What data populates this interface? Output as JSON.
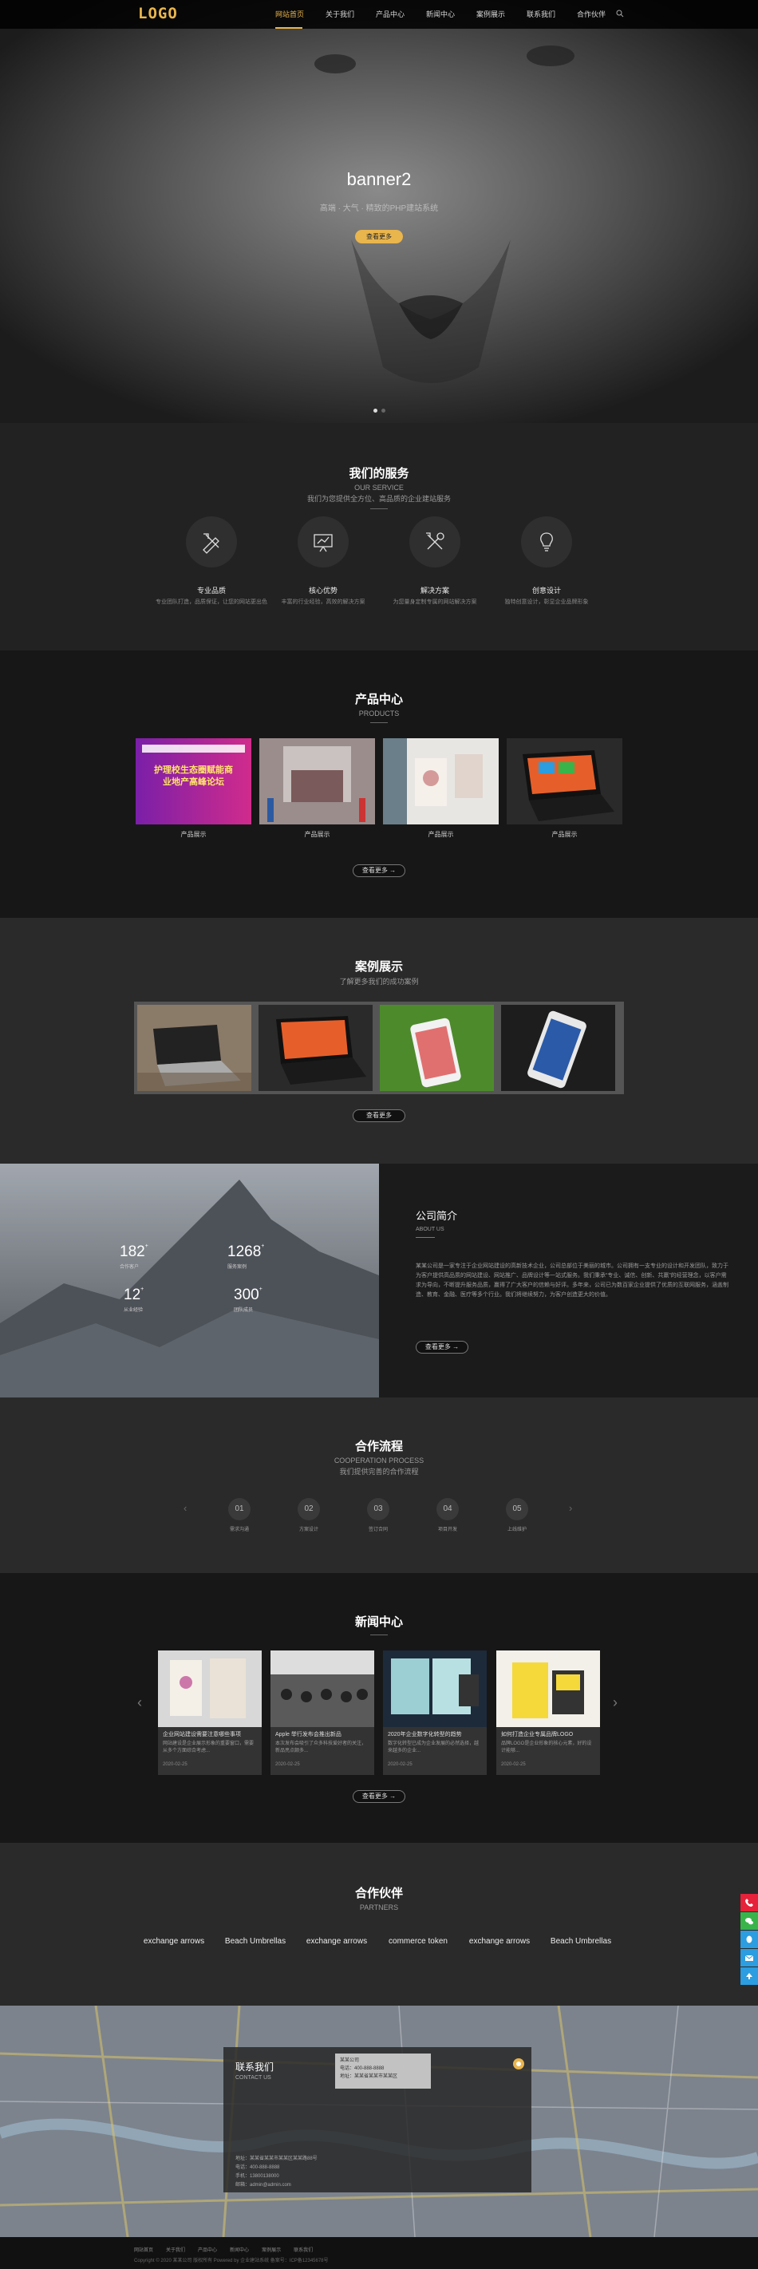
{
  "header": {
    "logo": "LOGO",
    "nav": [
      "网站首页",
      "关于我们",
      "产品中心",
      "新闻中心",
      "案例展示",
      "联系我们",
      "合作伙伴"
    ],
    "colors": {
      "accent": "#e9b54d"
    }
  },
  "hero": {
    "title": "banner2",
    "subtitle": "高端 · 大气 · 精致的PHP建站系统",
    "button": "查看更多"
  },
  "services": {
    "title": "我们的服务",
    "en": "OUR SERVICE",
    "sub": "我们为您提供全方位、高品质的企业建站服务",
    "items": [
      {
        "icon": "pen-ruler-icon",
        "title": "专业品质",
        "desc": "专业团队打造，品质保证，让您的网站更出色"
      },
      {
        "icon": "chart-board-icon",
        "title": "核心优势",
        "desc": "丰富的行业经验，高效的解决方案"
      },
      {
        "icon": "tools-icon",
        "title": "解决方案",
        "desc": "为您量身定制专属的网站解决方案"
      },
      {
        "icon": "bulb-icon",
        "title": "创意设计",
        "desc": "独特创意设计，彰显企业品牌形象"
      }
    ]
  },
  "products": {
    "title": "产品中心",
    "en": "PRODUCTS",
    "items": [
      {
        "caption": "产品展示",
        "img_text": "护理校生态圈赋能商业地产高峰论坛"
      },
      {
        "caption": "产品展示"
      },
      {
        "caption": "产品展示"
      },
      {
        "caption": "产品展示"
      }
    ],
    "more": "查看更多 →"
  },
  "cases": {
    "title": "案例展示",
    "sub": "了解更多我们的成功案例",
    "more": "查看更多"
  },
  "about": {
    "stats": [
      {
        "n": "182",
        "sup": "+",
        "l": "合作客户"
      },
      {
        "n": "1268",
        "sup": "+",
        "l": "服务案例"
      },
      {
        "n": "12",
        "sup": "+",
        "l": "从业经验"
      },
      {
        "n": "300",
        "sup": "+",
        "l": "团队成员"
      }
    ],
    "title": "公司简介",
    "en": "ABOUT US",
    "text": "某某公司是一家专注于企业网站建设的高新技术企业，公司总部位于美丽的城市。公司拥有一支专业的设计和开发团队，致力于为客户提供高品质的网站建设、网站推广、品牌设计等一站式服务。我们秉承“专业、诚信、创新、共赢”的经营理念，以客户需求为导向，不断提升服务品质，赢得了广大客户的信赖与好评。多年来，公司已为数百家企业提供了优质的互联网服务，涵盖制造、教育、金融、医疗等多个行业。我们将继续努力，为客户创造更大的价值。",
    "more": "查看更多 →"
  },
  "process": {
    "title": "合作流程",
    "en": "COOPERATION PROCESS",
    "sub": "我们提供完善的合作流程",
    "steps": [
      {
        "n": "01",
        "l": "需求沟通"
      },
      {
        "n": "02",
        "l": "方案设计"
      },
      {
        "n": "03",
        "l": "签订合同"
      },
      {
        "n": "04",
        "l": "项目开发"
      },
      {
        "n": "05",
        "l": "上线维护"
      }
    ]
  },
  "news": {
    "title": "新闻中心",
    "items": [
      {
        "t": "企业网站建设需要注意哪些事项",
        "d": "网站建设是企业展示形象的重要窗口，需要从多个方面综合考虑...",
        "date": "2020-02-25"
      },
      {
        "t": "Apple 举行发布会推出新品",
        "d": "本次发布会吸引了众多科技爱好者的关注，新品亮点颇多...",
        "date": "2020-02-25"
      },
      {
        "t": "2020年企业数字化转型的趋势",
        "d": "数字化转型已成为企业发展的必然选择，越来越多的企业...",
        "date": "2020-02-25"
      },
      {
        "t": "如何打造企业专属品牌LOGO",
        "d": "品牌LOGO是企业形象的核心元素，好的设计能够...",
        "date": "2020-02-25"
      }
    ],
    "more": "查看更多 →"
  },
  "partners": {
    "title": "合作伙伴",
    "en": "PARTNERS",
    "logos": [
      "exchange arrows",
      "Beach Umbrellas",
      "exchange arrows",
      "commerce token",
      "exchange arrows",
      "Beach Umbrellas"
    ]
  },
  "contact": {
    "title": "联系我们",
    "en": "CONTACT US",
    "lines": [
      "地址：某某省某某市某某区某某路88号",
      "电话：400-888-8888",
      "手机：13800138000",
      "邮箱：admin@admin.com"
    ],
    "popup": [
      "某某公司",
      "电话：400-888-8888",
      "地址：某某省某某市某某区"
    ]
  },
  "footer": {
    "nav": [
      "网站首页",
      "关于我们",
      "产品中心",
      "新闻中心",
      "案例展示",
      "联系我们"
    ],
    "copy": "Copyright © 2020 某某公司 版权所有 Powered by 企业建站系统 备案号：ICP备12345678号"
  },
  "sidebar": {
    "colors": [
      "#e6213a",
      "#39b44a",
      "#2b9de0",
      "#2b9de0",
      "#2b9de0"
    ],
    "icons": [
      "phone-icon",
      "wechat-icon",
      "qq-icon",
      "mail-icon",
      "top-icon"
    ]
  }
}
